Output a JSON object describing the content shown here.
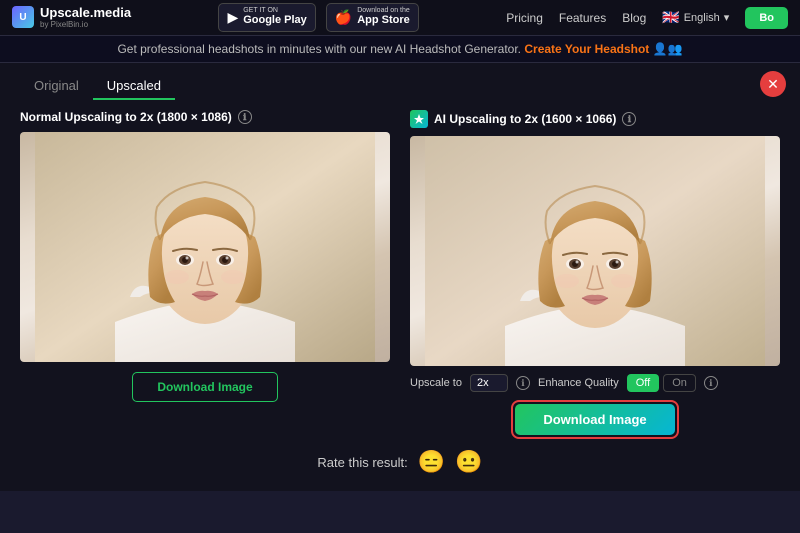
{
  "header": {
    "logo_main": "Upscale.media",
    "logo_sub": "by PixelBin.io",
    "google_play_small": "GET IT ON",
    "google_play_large": "Google Play",
    "app_store_small": "Download on the",
    "app_store_large": "App Store",
    "nav": {
      "pricing": "Pricing",
      "features": "Features",
      "blog": "Blog",
      "language": "English",
      "cta": "Bo"
    }
  },
  "banner": {
    "text": "Get professional headshots in minutes with our new AI Headshot Generator.",
    "link_text": "Create Your Headshot"
  },
  "tabs": [
    {
      "label": "Original",
      "active": false
    },
    {
      "label": "Upscaled",
      "active": true
    }
  ],
  "panels": {
    "left": {
      "title": "Normal Upscaling to 2x (1800 × 1086)",
      "info_icon": "ℹ",
      "download_label": "Download Image"
    },
    "right": {
      "title": "AI Upscaling to 2x (1600 × 1066)",
      "info_icon": "ℹ",
      "ai_icon": "↑",
      "upscale_label": "Upscale to",
      "upscale_value": "2x",
      "quality_label": "Enhance Quality",
      "toggle_off": "Off",
      "toggle_on": "On",
      "download_label": "Download Image"
    }
  },
  "rating": {
    "label": "Rate this result:",
    "emoji1": "😑",
    "emoji2": "😐"
  },
  "close_icon": "✕"
}
